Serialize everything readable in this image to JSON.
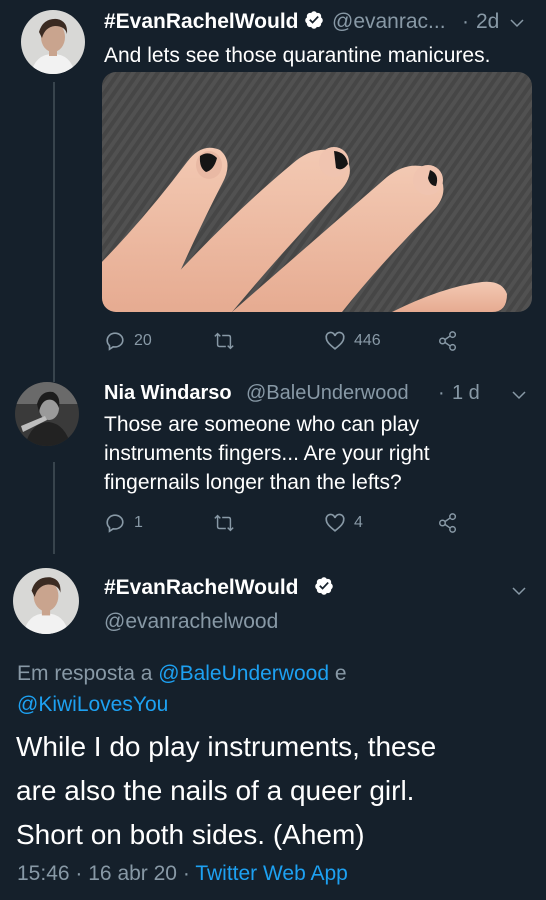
{
  "tweet1": {
    "display_name": "#EvanRachelWould",
    "handle": "@evanrac...",
    "time_sep": "·",
    "time": "2d",
    "text": "And lets see those quarantine manicures.",
    "replies": "20",
    "likes": "446"
  },
  "tweet2": {
    "display_name": "Nia Windarso",
    "handle": "@BaleUnderwood",
    "time_sep": "·",
    "time": "1 d",
    "text_lines": [
      "Those are someone who can play",
      "instruments fingers... Are your right",
      "fingernails longer than the lefts?"
    ],
    "replies": "1",
    "likes": "4"
  },
  "main": {
    "display_name": "#EvanRachelWould",
    "handle": "@evanrachelwood",
    "reply_prefix": "Em resposta a",
    "mention1": "@BaleUnderwood",
    "conj": "e",
    "mention2": "@KiwiLovesYou",
    "text_lines": [
      "While I do play instruments, these",
      "are also the nails of a queer girl.",
      "Short on both sides. (Ahem)"
    ],
    "time": "15:46",
    "sep": "·",
    "date": "16 abr 20",
    "source": "Twitter Web App"
  },
  "colors": {
    "background": "#15202b",
    "secondary_text": "#8899a6",
    "link": "#1da1f2",
    "verified": "#ffffff"
  },
  "icons": [
    "verified-badge-icon",
    "chevron-down-icon",
    "reply-icon",
    "retweet-icon",
    "like-icon",
    "share-icon"
  ]
}
